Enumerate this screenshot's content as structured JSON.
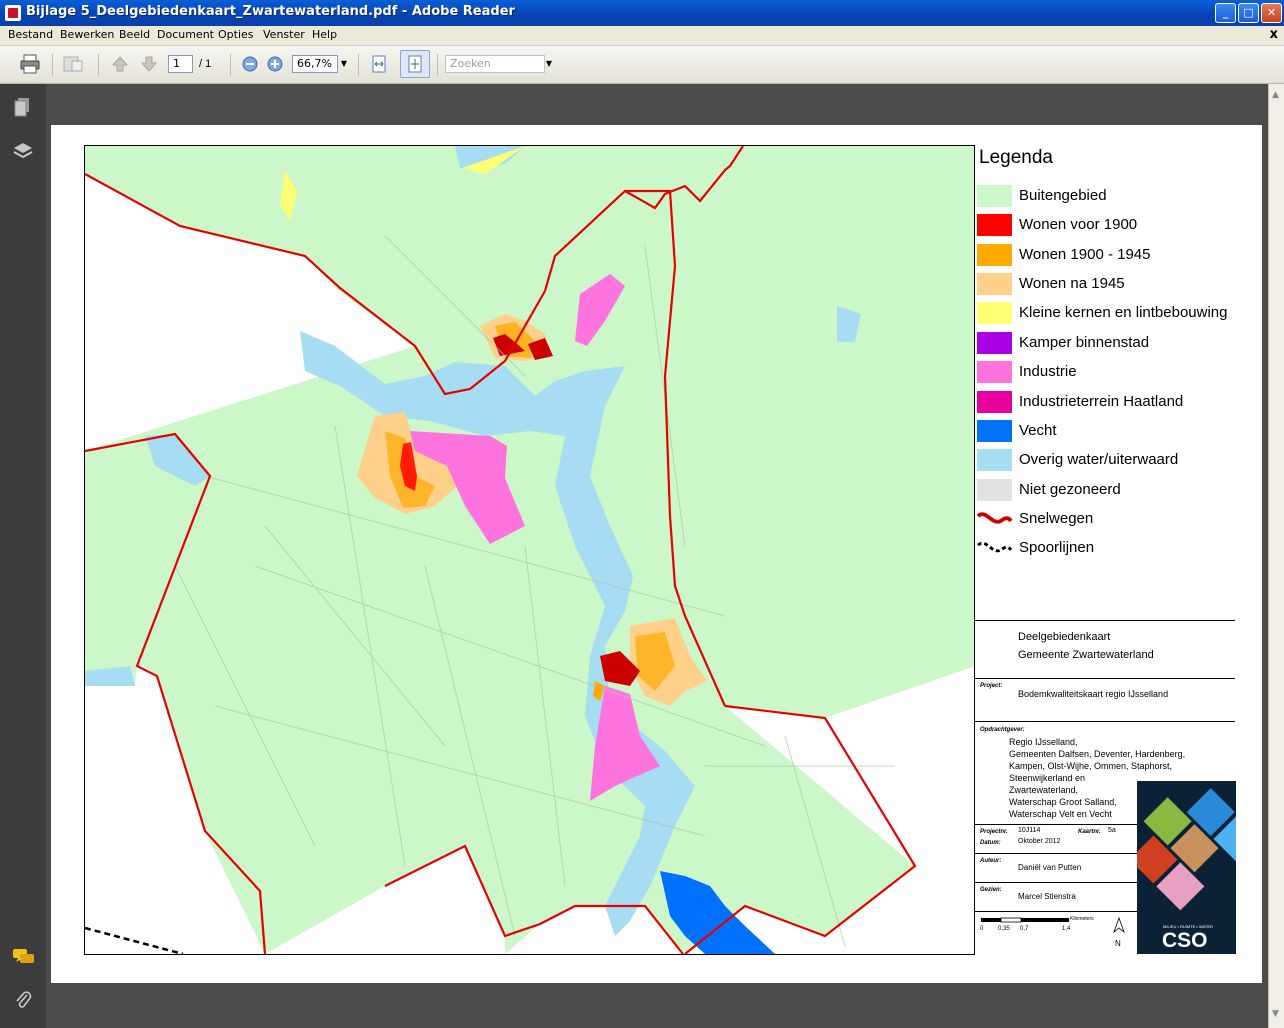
{
  "window": {
    "title": "Bijlage 5_Deelgebiedenkaart_Zwartewaterland.pdf - Adobe Reader",
    "buttons": {
      "minimize": "_",
      "maximize": "□",
      "close": "✕"
    }
  },
  "menu": {
    "items": [
      "Bestand",
      "Bewerken",
      "Beeld",
      "Document",
      "Opties",
      "Venster",
      "Help"
    ],
    "close_glyph": "x"
  },
  "toolbar": {
    "page_current": "1",
    "page_total": "/ 1",
    "zoom": "66,7%",
    "search_placeholder": "Zoeken",
    "icons": [
      "print-icon",
      "collab-icon",
      "prev-page-icon",
      "next-page-icon",
      "zoom-out-icon",
      "zoom-in-icon",
      "fit-width-icon",
      "fit-page-icon"
    ]
  },
  "legend": {
    "title": "Legenda",
    "items": [
      {
        "label": "Buitengebied",
        "color": "#ccf7c8"
      },
      {
        "label": "Wonen voor 1900",
        "color": "#ff0000"
      },
      {
        "label": "Wonen 1900 - 1945",
        "color": "#ffaa00"
      },
      {
        "label": "Wonen na 1945",
        "color": "#ffd08a"
      },
      {
        "label": "Kleine kernen en lintbebouwing",
        "color": "#ffff73"
      },
      {
        "label": "Kamper binnenstad",
        "color": "#a900e6"
      },
      {
        "label": "Industrie",
        "color": "#ff73df"
      },
      {
        "label": "Industrieterrein Haatland",
        "color": "#e6009e"
      },
      {
        "label": "Vecht",
        "color": "#0070ff"
      },
      {
        "label": "Overig water/uiterwaard",
        "color": "#a6ddf2"
      },
      {
        "label": "Niet gezoneerd",
        "color": "#e1e1e1"
      },
      {
        "label": "Snelwegen",
        "color": "#e60000"
      },
      {
        "label": "Spoorlijnen",
        "color": "#000000"
      }
    ]
  },
  "map_info": {
    "map_title_1": "Deelgebiedenkaart",
    "map_title_2": "Gemeente Zwartewaterland",
    "project_label": "Project:",
    "project": "Bodemkwaliteitskaart regio IJsselland",
    "client_label": "Opdrachtgever:",
    "client_lines": [
      "Regio IJsselland,",
      "Gemeenten Dalfsen, Deventer, Hardenberg,",
      "Kampen, Olst-Wijhe, Ommen, Staphorst,",
      "Steenwijkerland en",
      "Zwartewaterland,",
      "Waterschap Groot Salland,",
      "Waterschap Velt en Vecht"
    ],
    "projectnr_label": "Projectnr.",
    "projectnr": "10J114",
    "map_no_label": "Kaartnr.",
    "map_no": "5a",
    "date_label": "Datum:",
    "date": "Oktober 2012",
    "author_label": "Auteur:",
    "author": "Daniël van Putten",
    "checked_label": "Gezien:",
    "checked": "Marcel Stienstra",
    "scale_unit": "Kilometers",
    "scale_ticks": [
      "0",
      "0,35",
      "0,7",
      "1,4"
    ],
    "north": "N",
    "logo_tagline": "MILIEU • RUIMTE • WATER",
    "logo_text": "CSO"
  }
}
